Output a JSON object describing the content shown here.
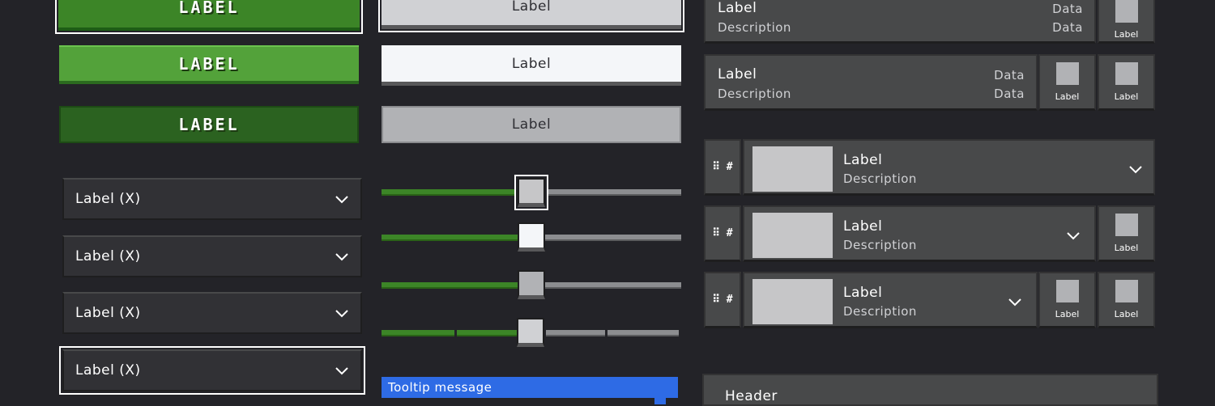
{
  "green_buttons": {
    "hover_label": "LABEL",
    "normal_label": "LABEL",
    "pressed_label": "LABEL"
  },
  "light_buttons": {
    "hover_label": "Label",
    "normal_label": "Label",
    "pressed_label": "Label"
  },
  "dropdowns": [
    {
      "label": "Label (X)"
    },
    {
      "label": "Label (X)"
    },
    {
      "label": "Label (X)"
    },
    {
      "label": "Label (X)"
    }
  ],
  "sliders": [
    {
      "value": 0.5
    },
    {
      "value": 0.5
    },
    {
      "value": 0.5
    },
    {
      "value": 0.5,
      "steps": 4
    }
  ],
  "tooltip": {
    "message": "Tooltip message"
  },
  "list_rows": [
    {
      "title": "Label",
      "description": "Description",
      "data1": "Data",
      "data2": "Data",
      "icon_labels": [
        "Label"
      ]
    },
    {
      "title": "Label",
      "description": "Description",
      "data1": "Data",
      "data2": "Data",
      "icon_labels": [
        "Label",
        "Label"
      ]
    }
  ],
  "media_rows": [
    {
      "handle": "⠿ #",
      "title": "Label",
      "description": "Description",
      "icon_labels": []
    },
    {
      "handle": "⠿ #",
      "title": "Label",
      "description": "Description",
      "icon_labels": [
        "Label"
      ]
    },
    {
      "handle": "⠿ #",
      "title": "Label",
      "description": "Description",
      "icon_labels": [
        "Label",
        "Label"
      ]
    }
  ],
  "panel": {
    "header": "Header"
  },
  "colors": {
    "background": "#232328",
    "green_primary": "#53a23a",
    "green_hover": "#3c8527",
    "green_pressed": "#2b6220",
    "tooltip_blue": "#2e6be5",
    "row_gray": "#48494a"
  }
}
